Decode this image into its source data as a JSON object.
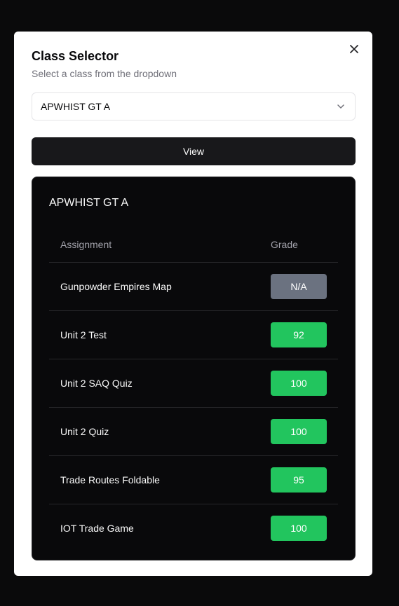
{
  "dialog": {
    "title": "Class Selector",
    "subtitle": "Select a class from the dropdown",
    "close_icon": "close-icon"
  },
  "select": {
    "value": "APWHIST GT A",
    "icon": "chevron-down-icon"
  },
  "view_button": {
    "label": "View"
  },
  "card": {
    "title": "APWHIST GT A",
    "columns": {
      "assignment": "Assignment",
      "grade": "Grade"
    },
    "rows": [
      {
        "assignment": "Gunpowder Empires Map",
        "grade": "N/A",
        "status": "na"
      },
      {
        "assignment": "Unit 2 Test",
        "grade": "92",
        "status": "good"
      },
      {
        "assignment": "Unit 2 SAQ Quiz",
        "grade": "100",
        "status": "good"
      },
      {
        "assignment": "Unit 2 Quiz",
        "grade": "100",
        "status": "good"
      },
      {
        "assignment": "Trade Routes Foldable",
        "grade": "95",
        "status": "good"
      },
      {
        "assignment": "IOT Trade Game",
        "grade": "100",
        "status": "good"
      }
    ]
  },
  "colors": {
    "backdrop": "#0a0a0b",
    "primary_button": "#18181b",
    "badge_na": "#6b7280",
    "badge_good": "#22c55e"
  }
}
